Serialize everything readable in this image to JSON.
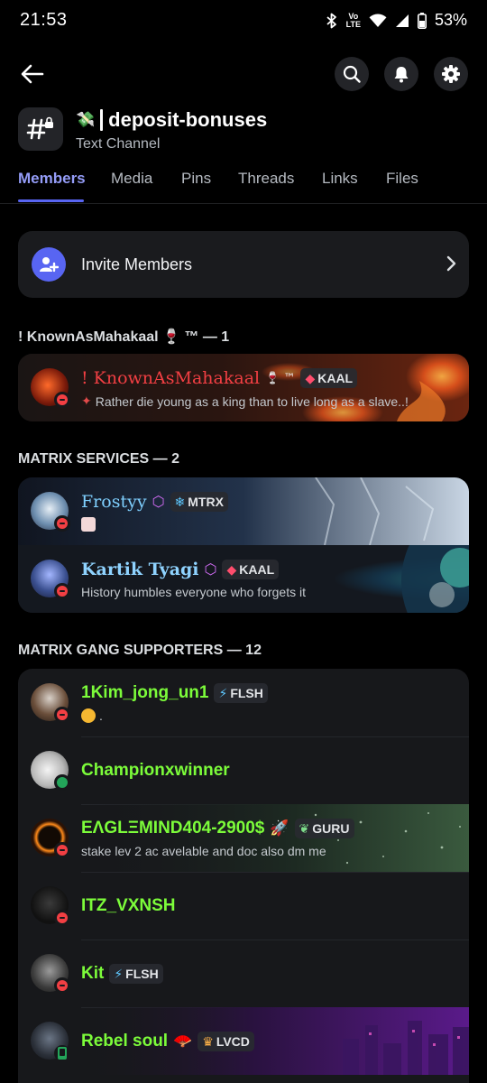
{
  "status_bar": {
    "time": "21:53",
    "battery": "53%",
    "network": "VoLTE"
  },
  "header": {
    "channel_name": "deposit-bonuses",
    "channel_emoji": "💸",
    "channel_type": "Text Channel"
  },
  "tabs": [
    {
      "label": "Members",
      "active": true
    },
    {
      "label": "Media"
    },
    {
      "label": "Pins"
    },
    {
      "label": "Threads"
    },
    {
      "label": "Links"
    },
    {
      "label": "Files"
    }
  ],
  "invite": {
    "label": "Invite Members"
  },
  "sections": [
    {
      "title": "! KnownAsMahakaal 🍷 ™ — 1"
    },
    {
      "title": "MATRIX SERVICES — 2"
    },
    {
      "title": "MATRIX GANG SUPPORTERS — 12"
    }
  ],
  "members": [
    {
      "name": "! KnownAsMahakaal",
      "name_suffix": "🍷 ™",
      "tag": "KAAL",
      "tag_icon": "gem-icon",
      "status": "Rather die young as a king than to live long as a slave..!",
      "presence": "dnd",
      "color": "#f23f43"
    },
    {
      "name": "Frostyy",
      "tag": "MTRX",
      "tag_icon": "snowflake-icon",
      "status": "",
      "presence": "dnd",
      "color": "#7fd0ff"
    },
    {
      "name": "Kartik Tyagi",
      "tag": "KAAL",
      "tag_icon": "gem-icon",
      "status": "History humbles everyone who forgets it",
      "presence": "dnd",
      "color": "#8fd3ff"
    },
    {
      "name": "1Kim_jong_un1",
      "tag": "FLSH",
      "tag_icon": "bolt-icon",
      "status": ".",
      "presence": "dnd",
      "color": "#7cfc3a"
    },
    {
      "name": "Championxwinner",
      "tag": "",
      "status": "",
      "presence": "online",
      "color": "#7cfc3a"
    },
    {
      "name": "ΕΛGLΞMIND404-2900$",
      "name_suffix": "🚀",
      "tag": "GURU",
      "tag_icon": "leaf-icon",
      "status": "stake lev 2 ac avelable and doc also dm me",
      "presence": "dnd",
      "color": "#7cfc3a"
    },
    {
      "name": "ITZ_VXNSH",
      "tag": "",
      "status": "",
      "presence": "dnd",
      "color": "#7cfc3a"
    },
    {
      "name": "Kit",
      "tag": "FLSH",
      "tag_icon": "bolt-icon",
      "status": "",
      "presence": "dnd",
      "color": "#7cfc3a"
    },
    {
      "name": "Rebel soul",
      "name_suffix": "🪭",
      "tag": "LVCD",
      "tag_icon": "crown-icon",
      "status": "",
      "presence": "mobile",
      "color": "#7cfc3a"
    }
  ]
}
